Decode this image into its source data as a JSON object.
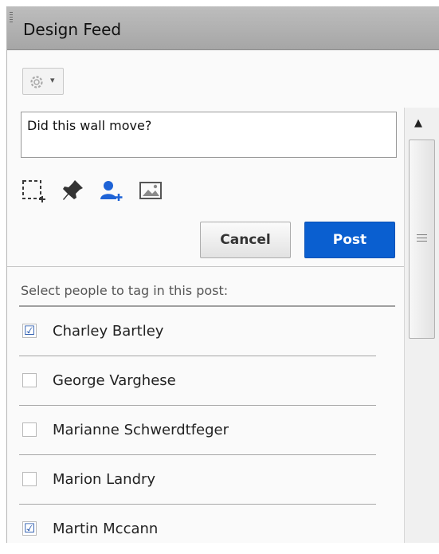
{
  "panel": {
    "title": "Design Feed"
  },
  "toolbar": {
    "settings_icon": "gear-icon",
    "dropdown_icon": "chevron-down-icon",
    "caret": "▾"
  },
  "composer": {
    "text": "Did this wall move?"
  },
  "tools": [
    {
      "name": "region-select-icon"
    },
    {
      "name": "pin-icon"
    },
    {
      "name": "add-person-icon",
      "active": true,
      "color": "#1e63d6"
    },
    {
      "name": "image-icon"
    }
  ],
  "actions": {
    "cancel_label": "Cancel",
    "post_label": "Post",
    "post_color": "#0a5fd0"
  },
  "tagging": {
    "prompt": "Select people to tag in this post:",
    "people": [
      {
        "name": "Charley Bartley",
        "checked": true,
        "mark": "☑"
      },
      {
        "name": "George Varghese",
        "checked": false,
        "mark": ""
      },
      {
        "name": "Marianne Schwerdtfeger",
        "checked": false,
        "mark": ""
      },
      {
        "name": "Marion Landry",
        "checked": false,
        "mark": ""
      },
      {
        "name": "Martin Mccann",
        "checked": true,
        "mark": "☑"
      }
    ]
  },
  "scrollbar": {
    "up_arrow": "▲"
  }
}
